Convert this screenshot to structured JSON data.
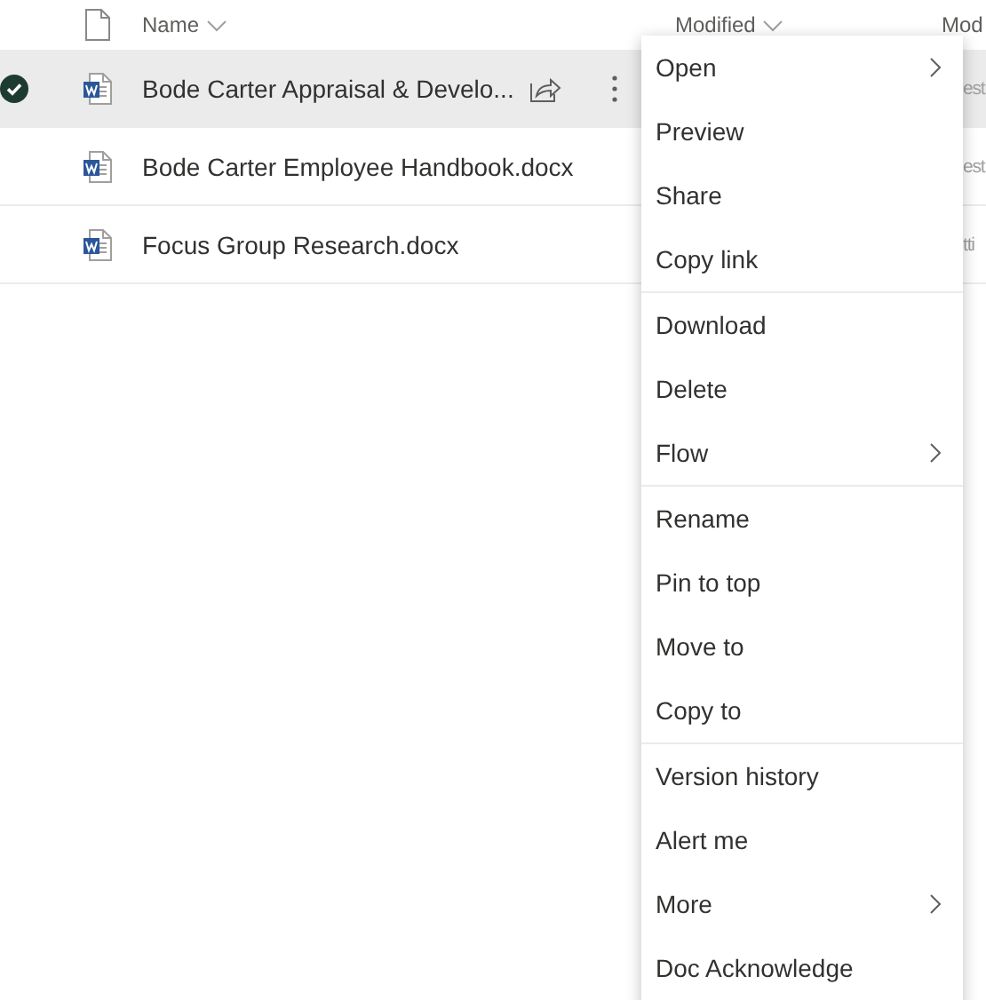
{
  "table": {
    "columns": [
      {
        "label": "Name",
        "sort_caret": true
      },
      {
        "label": "Modified",
        "sort_caret": true
      },
      {
        "label": "Mod"
      }
    ],
    "rows": [
      {
        "name": "Bode Carter Appraisal & Develo...",
        "selected": true,
        "column_3": "est"
      },
      {
        "name": "Bode Carter Employee Handbook.docx",
        "selected": false,
        "column_3": "est"
      },
      {
        "name": "Focus Group Research.docx",
        "selected": false,
        "column_3": "tti"
      }
    ]
  },
  "context_menu": {
    "groups": [
      [
        {
          "label": "Open",
          "submenu": true
        },
        {
          "label": "Preview",
          "submenu": false
        },
        {
          "label": "Share",
          "submenu": false
        },
        {
          "label": "Copy link",
          "submenu": false
        }
      ],
      [
        {
          "label": "Download",
          "submenu": false
        },
        {
          "label": "Delete",
          "submenu": false
        },
        {
          "label": "Flow",
          "submenu": true
        }
      ],
      [
        {
          "label": "Rename",
          "submenu": false
        },
        {
          "label": "Pin to top",
          "submenu": false
        },
        {
          "label": "Move to",
          "submenu": false
        },
        {
          "label": "Copy to",
          "submenu": false
        }
      ],
      [
        {
          "label": "Version history",
          "submenu": false
        },
        {
          "label": "Alert me",
          "submenu": false
        },
        {
          "label": "More",
          "submenu": true
        },
        {
          "label": "Doc Acknowledge",
          "submenu": false
        }
      ]
    ]
  }
}
